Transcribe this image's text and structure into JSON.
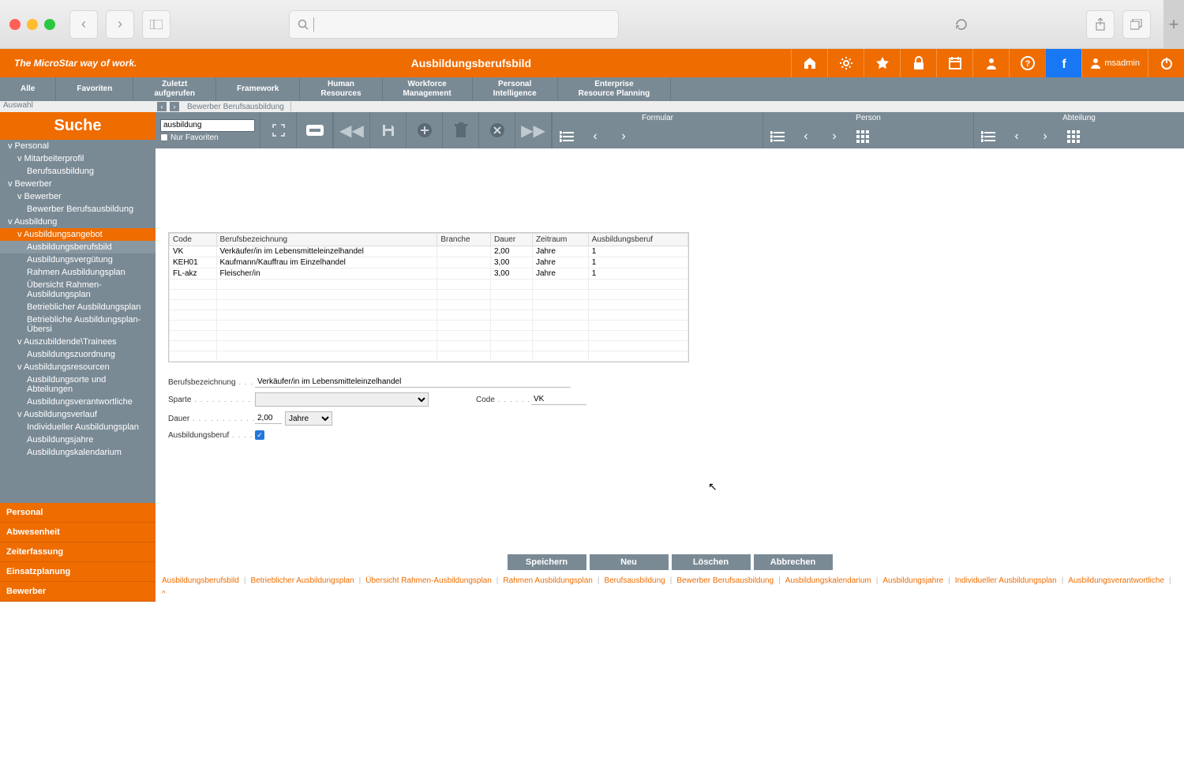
{
  "slogan": "The MicroStar way of work.",
  "page_title": "Ausbildungsberufsbild",
  "user": "msadmin",
  "menus": [
    "Alle",
    "Favoriten",
    "Zuletzt aufgerufen",
    "Framework",
    "Human Resources",
    "Workforce Management",
    "Personal Intelligence",
    "Enterprise Resource Planning"
  ],
  "auswahl": "Auswahl",
  "suche": "Suche",
  "tree": [
    {
      "t": "Personal",
      "l": 0,
      "pre": "v"
    },
    {
      "t": "Mitarbeiterprofil",
      "l": 1,
      "pre": "v"
    },
    {
      "t": "Berufsausbildung",
      "l": 2
    },
    {
      "t": "Bewerber",
      "l": 0,
      "pre": "v"
    },
    {
      "t": "Bewerber",
      "l": 1,
      "pre": "v"
    },
    {
      "t": "Bewerber Berufsausbildung",
      "l": 2
    },
    {
      "t": "Ausbildung",
      "l": 0,
      "pre": "v"
    },
    {
      "t": "Ausbildungsangebot",
      "l": 1,
      "pre": "v",
      "cls": "active"
    },
    {
      "t": "Ausbildungsberufsbild",
      "l": 2,
      "cls": "lite"
    },
    {
      "t": "Ausbildungsvergütung",
      "l": 2
    },
    {
      "t": "Rahmen Ausbildungsplan",
      "l": 2
    },
    {
      "t": "Übersicht Rahmen-Ausbildungsplan",
      "l": 2
    },
    {
      "t": "Betrieblicher Ausbildungsplan",
      "l": 2
    },
    {
      "t": "Betriebliche Ausbildungsplan- Übersi",
      "l": 2
    },
    {
      "t": "Auszubildende\\Trainees",
      "l": 1,
      "pre": "v"
    },
    {
      "t": "Ausbildungszuordnung",
      "l": 2
    },
    {
      "t": "Ausbildungsresourcen",
      "l": 1,
      "pre": "v"
    },
    {
      "t": "Ausbildungsorte und Abteilungen",
      "l": 2
    },
    {
      "t": "Ausbildungsverantwortliche",
      "l": 2
    },
    {
      "t": "Ausbildungsverlauf",
      "l": 1,
      "pre": "v"
    },
    {
      "t": "Individueller Ausbildungsplan",
      "l": 2
    },
    {
      "t": "Ausbildungsjahre",
      "l": 2
    },
    {
      "t": "Ausbildungskalendarium",
      "l": 2
    }
  ],
  "categories": [
    "Personal",
    "Abwesenheit",
    "Zeiterfassung",
    "Einsatzplanung",
    "Bewerber"
  ],
  "breadcrumb": "Bewerber Berufsausbildung",
  "search_value": "ausbildung",
  "fav_label": "Nur Favoriten",
  "nav_groups": [
    "Formular",
    "Person",
    "Abteilung"
  ],
  "grid": {
    "cols": [
      "Code",
      "Berufsbezeichnung",
      "Branche",
      "Dauer",
      "Zeitraum",
      "Ausbildungsberuf"
    ],
    "rows": [
      {
        "Code": "VK",
        "Berufsbezeichnung": "Verkäufer/in im Lebensmitteleinzelhandel",
        "Branche": "",
        "Dauer": "2,00",
        "Zeitraum": "Jahre",
        "Ausbildungsberuf": "1"
      },
      {
        "Code": "KEH01",
        "Berufsbezeichnung": "Kaufmann/Kauffrau im Einzelhandel",
        "Branche": "",
        "Dauer": "3,00",
        "Zeitraum": "Jahre",
        "Ausbildungsberuf": "1"
      },
      {
        "Code": "FL-akz",
        "Berufsbezeichnung": "Fleischer/in",
        "Branche": "",
        "Dauer": "3,00",
        "Zeitraum": "Jahre",
        "Ausbildungsberuf": "1"
      }
    ]
  },
  "form": {
    "berufsbez_label": "Berufsbezeichnung",
    "berufsbez_value": "Verkäufer/in im Lebensmitteleinzelhandel",
    "sparte_label": "Sparte",
    "code_label": "Code",
    "code_value": "VK",
    "dauer_label": "Dauer",
    "dauer_value": "2,00",
    "zeitraum_value": "Jahre",
    "ausb_label": "Ausbildungsberuf"
  },
  "actions": {
    "save": "Speichern",
    "new": "Neu",
    "delete": "Löschen",
    "cancel": "Abbrechen"
  },
  "footer": [
    "Ausbildungsberufsbild",
    "Betrieblicher Ausbildungsplan",
    "Übersicht Rahmen-Ausbildungsplan",
    "Rahmen Ausbildungsplan",
    "Berufsausbildung",
    "Bewerber Berufsausbildung",
    "Ausbildungskalendarium",
    "Ausbildungsjahre",
    "Individueller Ausbildungsplan",
    "Ausbildungsverantwortliche",
    "^"
  ]
}
